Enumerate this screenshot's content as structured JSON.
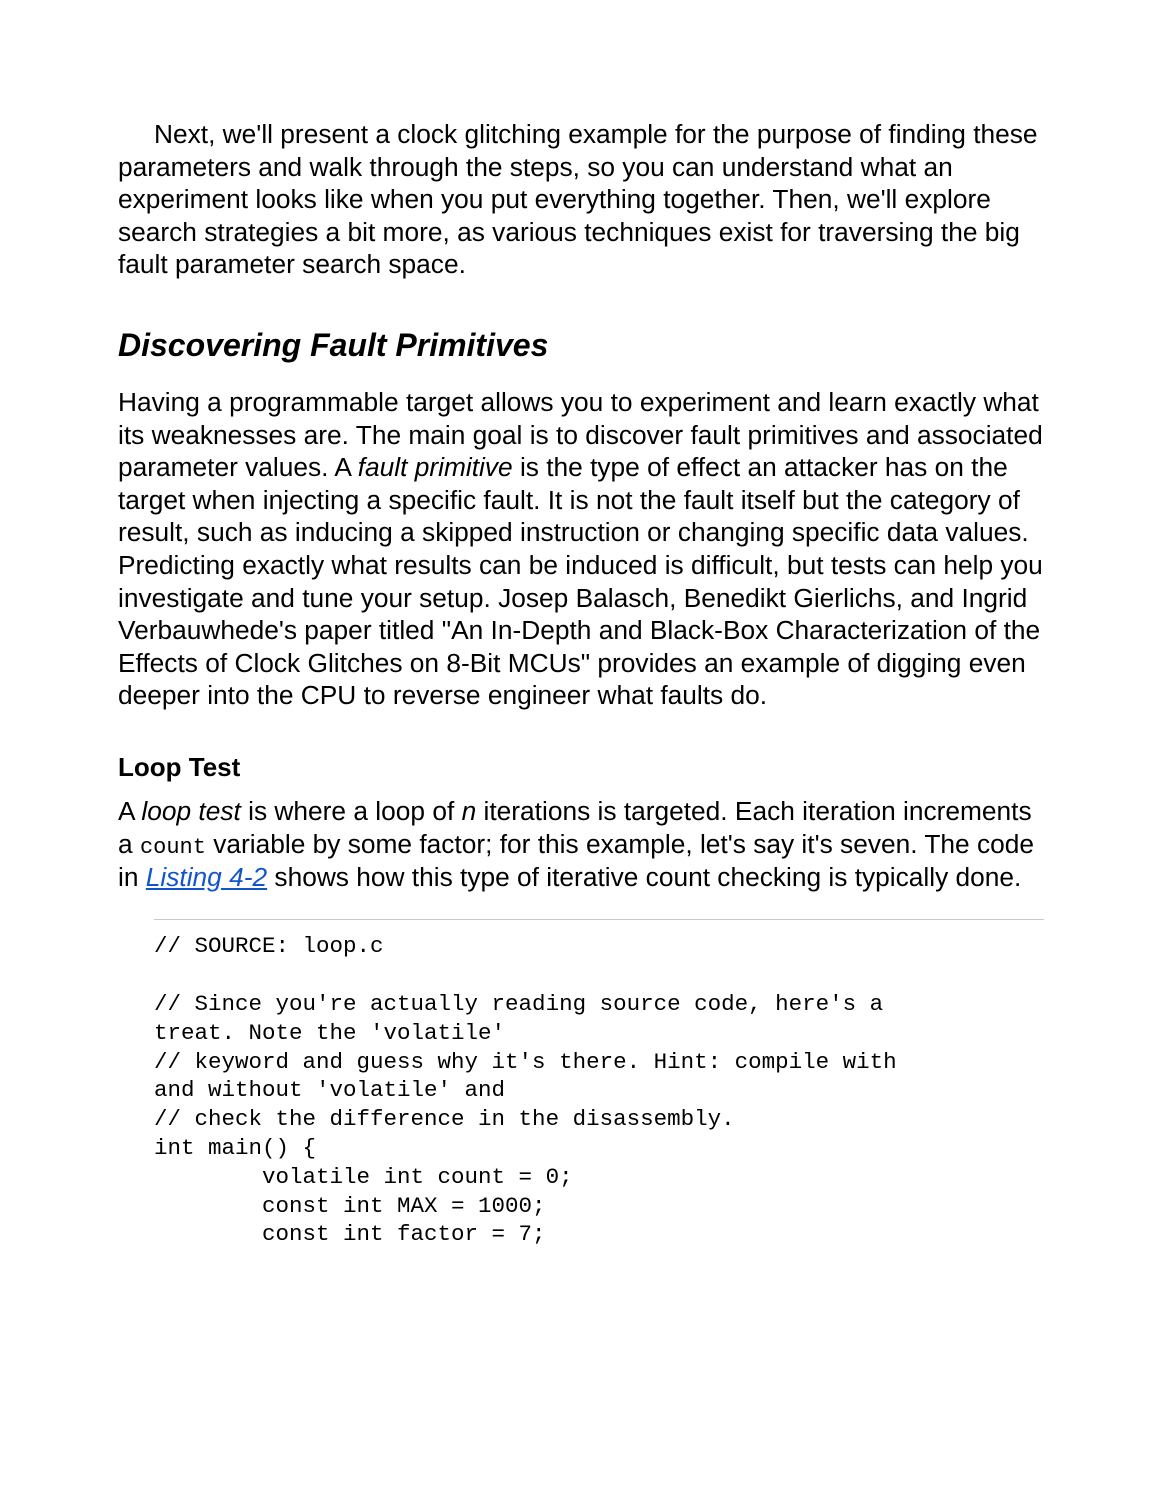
{
  "intro": "Next, we'll present a clock glitching example for the purpose of finding these parameters and walk through the steps, so you can understand what an experiment looks like when you put everything together. Then, we'll explore search strategies a bit more, as various techniques exist for traversing the big fault parameter search space.",
  "heading1": "Discovering Fault Primitives",
  "para1": {
    "p1": "Having a programmable target allows you to experiment and learn exactly what its weaknesses are. The main goal is to discover fault primitives and associated parameter values. A ",
    "em1": "fault primitive",
    "p2": " is the type of effect an attacker has on the target when injecting a specific fault. It is not the fault itself but the category of result, such as inducing a skipped instruction or changing specific data values. Predicting exactly what results can be induced is difficult, but tests can help you investigate and tune your setup. Josep Balasch, Benedikt Gierlichs, and Ingrid Verbauwhede's paper titled \"An In-Depth and Black-Box Characterization of the Effects of Clock Glitches on 8-Bit MCUs\" provides an example of digging even deeper into the CPU to reverse engineer what faults do."
  },
  "heading2": "Loop Test",
  "para2": {
    "p1": "A ",
    "em1": "loop test",
    "p2": " is where a loop of ",
    "em2": "n",
    "p3": " iterations is targeted. Each iteration increments a ",
    "code": "count",
    "p4": " variable by some factor; for this example, let's say it's seven. The code in ",
    "link": "Listing 4-2",
    "p5": " shows how this type of iterative count checking is typically done."
  },
  "codeblock": "// SOURCE: loop.c\n\n// Since you're actually reading source code, here's a\ntreat. Note the 'volatile'\n// keyword and guess why it's there. Hint: compile with\nand without 'volatile' and\n// check the difference in the disassembly.\nint main() {\n        volatile int count = 0;\n        const int MAX = 1000;\n        const int factor = 7;"
}
